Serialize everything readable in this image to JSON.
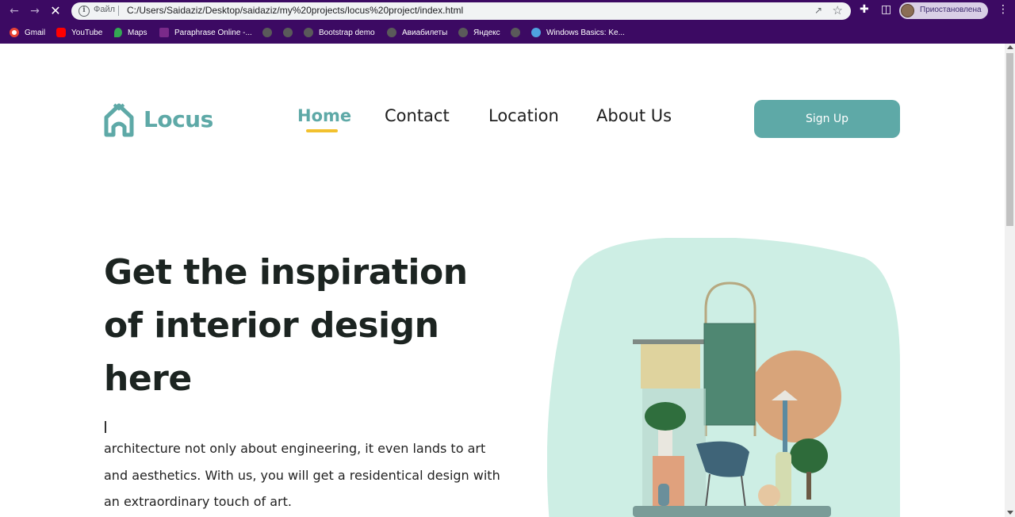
{
  "browser": {
    "file_label": "Файл",
    "url": "C:/Users/Saidaziz/Desktop/saidaziz/my%20projects/locus%20project/index.html",
    "profile_label": "Приостановлена",
    "bookmarks": [
      "Gmail",
      "YouTube",
      "Maps",
      "Paraphrase Online -...",
      "Bootstrap demo",
      "Авиабилеты",
      "Яндекс",
      "Windows Basics: Ke..."
    ]
  },
  "site": {
    "logo": "Locus",
    "nav": [
      "Home",
      "Contact",
      "Location",
      "About Us"
    ],
    "signup": "Sign Up"
  },
  "hero": {
    "headline": "Get the inspiration of interior design here",
    "paragraph": "architecture not only about engineering, it even lands to art and aesthetics. With us, you will get a residentical design with an extraordinary touch of art."
  },
  "colors": {
    "accent": "#5ea9a7",
    "underline": "#f2c12e",
    "blob": "#cdeee4",
    "browser_frame": "#3c0a63"
  }
}
